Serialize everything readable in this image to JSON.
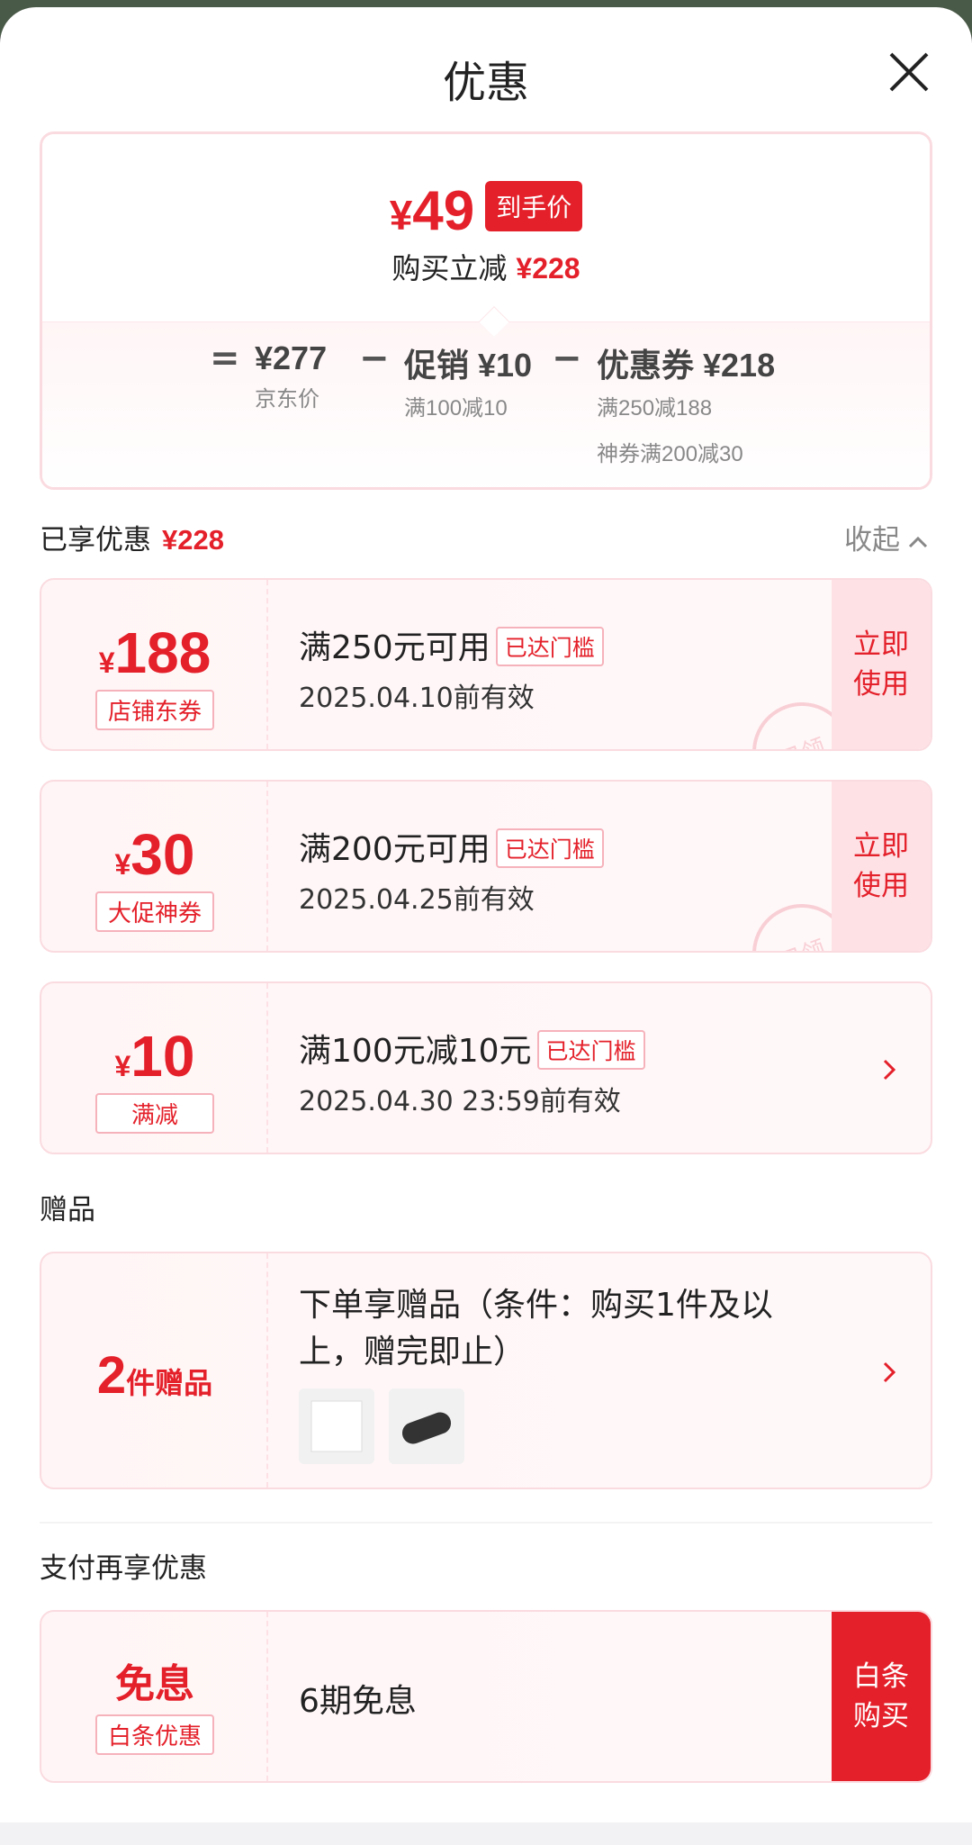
{
  "header": {
    "title": "优惠"
  },
  "summary": {
    "final_price_yen": "¥",
    "final_price": "49",
    "final_tag": "到手价",
    "discount_label": "购买立减",
    "discount_amount": "¥228",
    "equals": "=",
    "minus": "−",
    "items": [
      {
        "amount": "¥277",
        "label": "京东价"
      },
      {
        "amount": "促销 ¥10",
        "label": "满100减10"
      },
      {
        "amount": "优惠券 ¥218",
        "label": "满250减188",
        "label2": "神券满200减30"
      }
    ]
  },
  "enjoyed": {
    "label": "已享优惠",
    "amount": "¥228",
    "collapse": "收起"
  },
  "coupons": [
    {
      "yen": "¥",
      "amount": "188",
      "tag": "店铺东券",
      "title": "满250元可用",
      "badge": "已达门槛",
      "valid": "2025.04.10前有效",
      "action": "立即使用",
      "stamp": "已领"
    },
    {
      "yen": "¥",
      "amount": "30",
      "tag": "大促神券",
      "title": "满200元可用",
      "badge": "已达门槛",
      "valid": "2025.04.25前有效",
      "action": "立即使用",
      "stamp": "已领"
    },
    {
      "yen": "¥",
      "amount": "10",
      "tag": "满减",
      "title": "满100元减10元",
      "badge": "已达门槛",
      "valid": "2025.04.30 23:59前有效"
    }
  ],
  "gifts": {
    "section": "赠品",
    "count": "2",
    "count_unit": "件赠品",
    "title_line1": "下单享赠品（条件：购买1件及以",
    "title_line2": "上，赠完即止）",
    "images": [
      "gift-cloth-image",
      "gift-glasses-case-image"
    ]
  },
  "payment": {
    "section": "支付再享优惠",
    "amount": "免息",
    "tag": "白条优惠",
    "title": "6期免息",
    "action": "白条购买"
  },
  "colors": {
    "accent": "#e4202a",
    "card_bg": "#fff5f6",
    "border": "#fadbe0"
  }
}
